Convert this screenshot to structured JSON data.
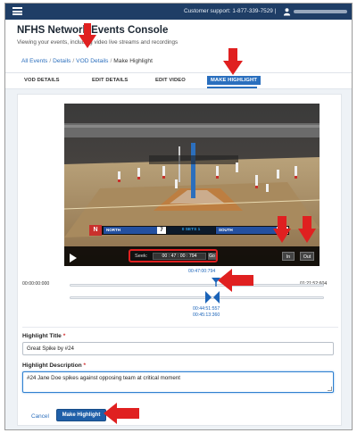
{
  "topbar": {
    "menu_icon": "hamburger-menu-icon",
    "support_text": "Customer support: 1-877-339-7529 |",
    "user_icon": "user-icon"
  },
  "header": {
    "title": "NFHS Network Events Console",
    "subtitle": "Viewing your events, including video live streams and recordings"
  },
  "breadcrumb": {
    "items": [
      "All Events",
      "Details",
      "VOD Details",
      "Make Highlight"
    ]
  },
  "tabs": [
    "VOD DETAILS",
    "EDIT DETAILS",
    "EDIT VIDEO",
    "MAKE HIGHLIGHT"
  ],
  "video": {
    "scoreboard": {
      "team_left": "NORTH",
      "score_left": "7",
      "sets": "0   SETS   1",
      "team_right": "SOUTH",
      "score_right": "12"
    },
    "seek_label": "Seek:",
    "seek_time": "00 : 47 : 00 : 794",
    "go_label": "Go",
    "in_label": "In",
    "out_label": "Out"
  },
  "timeline": {
    "start_time": "00:00:00:000",
    "end_time": "01:21:52:604",
    "playhead_time": "00:47:00:794",
    "in_time": "00:44:51:557",
    "out_time": "00:45:13:360",
    "playhead_fraction": 0.574,
    "in_fraction": 0.548
  },
  "form": {
    "highlight_title_label": "Highlight Title",
    "highlight_title_value": "Great Spike by #24",
    "highlight_description_label": "Highlight Description",
    "highlight_description_value": "#24 Jane Doe spikes against opposing team at critical moment",
    "required_mark": "*",
    "cancel_label": "Cancel",
    "make_highlight_label": "Make Highlight"
  },
  "colors": {
    "topbar_bg": "#1f3e66",
    "accent_blue": "#2a6fbe",
    "annotation_red": "#e02020"
  }
}
